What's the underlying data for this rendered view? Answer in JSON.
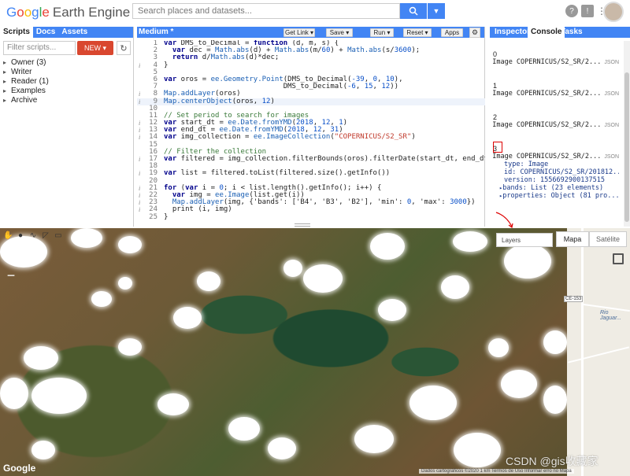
{
  "header": {
    "logo_google": "Google",
    "logo_rest": "Earth Engine",
    "search_placeholder": "Search places and datasets...",
    "icons": [
      "search-icon",
      "dropdown-icon",
      "help-icon",
      "feedback-icon",
      "apps-grid-icon",
      "avatar"
    ]
  },
  "left_panel": {
    "tabs": [
      "Scripts",
      "Docs",
      "Assets"
    ],
    "filter_placeholder": "Filter scripts...",
    "new_label": "NEW",
    "tree": [
      {
        "label": "Owner",
        "count": "(3)"
      },
      {
        "label": "Writer",
        "count": ""
      },
      {
        "label": "Reader",
        "count": "(1)"
      },
      {
        "label": "Examples",
        "count": ""
      },
      {
        "label": "Archive",
        "count": ""
      }
    ]
  },
  "editor": {
    "title": "Medium *",
    "buttons": [
      "Get Link",
      "Save",
      "Run",
      "Reset",
      "Apps"
    ],
    "lines": [
      {
        "n": "1",
        "info": "",
        "text": "var DMS_to_Decimal = function (d, m, s) {"
      },
      {
        "n": "2",
        "info": "",
        "text": "  var dec = Math.abs(d) + Math.abs(m/60) + Math.abs(s/3600);"
      },
      {
        "n": "3",
        "info": "",
        "text": "  return d/Math.abs(d)*dec;"
      },
      {
        "n": "4",
        "info": "i",
        "text": "}"
      },
      {
        "n": "5",
        "info": "",
        "text": ""
      },
      {
        "n": "6",
        "info": "",
        "text": "var oros = ee.Geometry.Point(DMS_to_Decimal(-39, 0, 10),"
      },
      {
        "n": "7",
        "info": "",
        "text": "                            DMS_to_Decimal(-6, 15, 12))"
      },
      {
        "n": "8",
        "info": "i",
        "text": "Map.addLayer(oros)"
      },
      {
        "n": "9",
        "info": "i",
        "text": "Map.centerObject(oros, 12)"
      },
      {
        "n": "10",
        "info": "",
        "text": ""
      },
      {
        "n": "11",
        "info": "",
        "text": "// Set period to search for images"
      },
      {
        "n": "12",
        "info": "i",
        "text": "var start_dt = ee.Date.fromYMD(2018, 12, 1)"
      },
      {
        "n": "13",
        "info": "i",
        "text": "var end_dt = ee.Date.fromYMD(2018, 12, 31)"
      },
      {
        "n": "14",
        "info": "i",
        "text": "var img_collection = ee.ImageCollection(\"COPERNICUS/S2_SR\")"
      },
      {
        "n": "15",
        "info": "",
        "text": ""
      },
      {
        "n": "16",
        "info": "",
        "text": "// Filter the collection"
      },
      {
        "n": "17",
        "info": "i",
        "text": "var filtered = img_collection.filterBounds(oros).filterDate(start_dt, end_dt)"
      },
      {
        "n": "18",
        "info": "",
        "text": ""
      },
      {
        "n": "19",
        "info": "i",
        "text": "var list = filtered.toList(filtered.size().getInfo())"
      },
      {
        "n": "20",
        "info": "",
        "text": ""
      },
      {
        "n": "21",
        "info": "i",
        "text": "for (var i = 0; i < list.length().getInfo(); i++) {"
      },
      {
        "n": "22",
        "info": "i",
        "text": "  var img = ee.Image(list.get(i))"
      },
      {
        "n": "23",
        "info": "i",
        "text": "  Map.addLayer(img, {'bands': ['B4', 'B3', 'B2'], 'min': 0, 'max': 3000})"
      },
      {
        "n": "24",
        "info": "i",
        "text": "  print (i, img)"
      },
      {
        "n": "25",
        "info": "",
        "text": "}"
      }
    ]
  },
  "right_panel": {
    "tabs": [
      "Inspector",
      "Console",
      "Tasks"
    ],
    "entries": [
      {
        "index": "0",
        "summary": "Image COPERNICUS/S2_SR/2...",
        "json": "JSON"
      },
      {
        "index": "1",
        "summary": "Image COPERNICUS/S2_SR/2...",
        "json": "JSON"
      },
      {
        "index": "2",
        "summary": "Image COPERNICUS/S2_SR/2...",
        "json": "JSON"
      },
      {
        "index": "3",
        "summary": "Image COPERNICUS/S2_SR/2...",
        "json": "JSON"
      }
    ],
    "expanded": [
      "type: Image",
      "id: COPERNICUS/S2_SR/201812...",
      "version: 1556692900137515",
      "bands: List (23 elements)",
      "properties: Object (81 pro..."
    ]
  },
  "map": {
    "layers_label": "Layers",
    "mapa_label": "Mapa",
    "satellite_label": "Satélite",
    "route_label": "CE-153",
    "place_label": "Rio Jaguar...",
    "google_mark": "Google",
    "attribution": "Dados cartográficos ©2020   1 km          Termos de Uso   Informar erro no Mapa",
    "watermark": "CSDN @gis收藏家"
  }
}
